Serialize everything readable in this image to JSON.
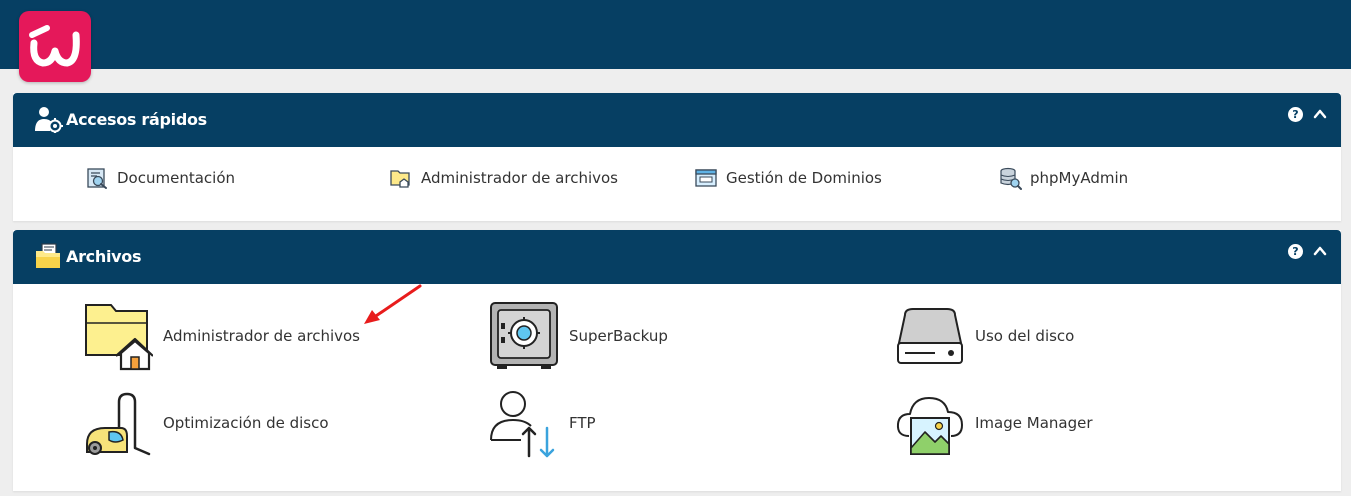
{
  "header": {
    "logo_icon": "brand-logo-icon",
    "background_color": "#063f63",
    "logo_color": "#e5185a"
  },
  "quick_access": {
    "title": "Accesos rápidos",
    "icon": "user-gear-icon",
    "help_icon": "help-icon",
    "collapse_icon": "chevron-up-icon",
    "items": [
      {
        "label": "Documentación",
        "icon": "documentation-icon"
      },
      {
        "label": "Administrador de archivos",
        "icon": "folder-home-icon"
      },
      {
        "label": "Gestión de Dominios",
        "icon": "domain-icon"
      },
      {
        "label": "phpMyAdmin",
        "icon": "database-search-icon"
      }
    ]
  },
  "files": {
    "title": "Archivos",
    "icon": "folder-open-icon",
    "help_icon": "help-icon",
    "collapse_icon": "chevron-up-icon",
    "items": [
      {
        "label": "Administrador de archivos",
        "icon": "folder-home-icon"
      },
      {
        "label": "SuperBackup",
        "icon": "safe-icon"
      },
      {
        "label": "Uso del disco",
        "icon": "disk-drive-icon"
      },
      {
        "label": "Optimización de disco",
        "icon": "vacuum-cleaner-icon"
      },
      {
        "label": "FTP",
        "icon": "user-transfer-icon"
      },
      {
        "label": "Image Manager",
        "icon": "cloud-image-icon"
      }
    ]
  },
  "annotation": {
    "arrow_color": "#e81c1c",
    "icon": "red-arrow-icon"
  }
}
